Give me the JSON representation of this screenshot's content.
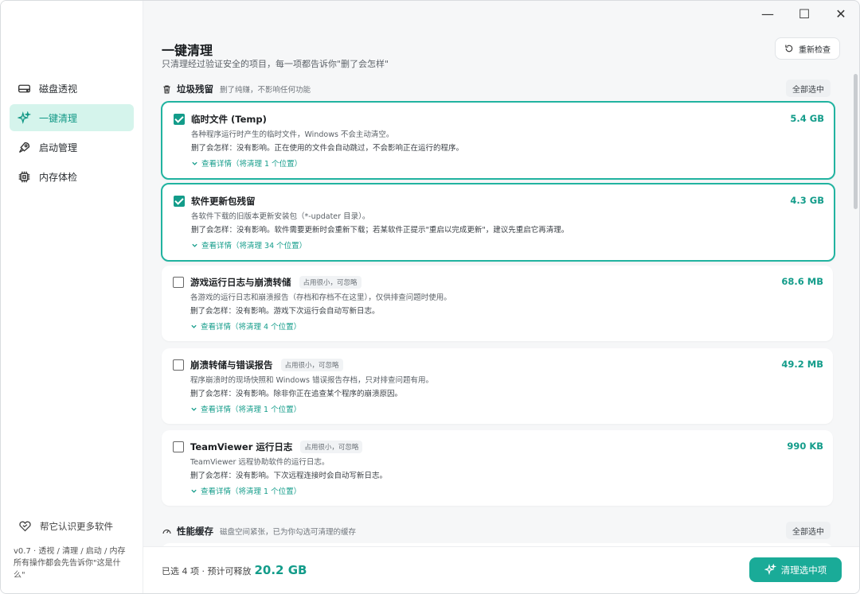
{
  "window": {
    "minimize": "—",
    "maximize": "☐",
    "close": "✕"
  },
  "sidebar": {
    "items": [
      {
        "label": "磁盘透视",
        "icon": "disk-icon",
        "active": false
      },
      {
        "label": "一键清理",
        "icon": "sparkle-icon",
        "active": true
      },
      {
        "label": "启动管理",
        "icon": "rocket-icon",
        "active": false
      },
      {
        "label": "内存体检",
        "icon": "chip-icon",
        "active": false
      }
    ],
    "help_label": "帮它认识更多软件",
    "version_text": "v0.7 · 透视 / 清理 / 启动 / 内存\n所有操作都会先告诉你\"这是什么\""
  },
  "header": {
    "title": "一键清理",
    "subtitle": "只清理经过验证安全的项目，每一项都告诉你\"删了会怎样\"",
    "recheck_label": "重新检查"
  },
  "sections": [
    {
      "title": "垃圾残留",
      "desc": "删了纯赚，不影响任何功能",
      "select_all": "全部选中",
      "items": [
        {
          "title": "临时文件 (Temp)",
          "tag": "",
          "size": "5.4 GB",
          "checked": true,
          "desc": "各种程序运行时产生的临时文件，Windows 不会主动清空。",
          "effect": "删了会怎样：没有影响。正在使用的文件会自动跳过，不会影响正在运行的程序。",
          "detail": "查看详情（将清理 1 个位置）"
        },
        {
          "title": "软件更新包残留",
          "tag": "",
          "size": "4.3 GB",
          "checked": true,
          "desc": "各软件下载的旧版本更新安装包（*-updater 目录）。",
          "effect": "删了会怎样：没有影响。软件需要更新时会重新下载；若某软件正提示\"重启以完成更新\"，建议先重启它再清理。",
          "detail": "查看详情（将清理 34 个位置）"
        },
        {
          "title": "游戏运行日志与崩溃转储",
          "tag": "占用很小，可忽略",
          "size": "68.6 MB",
          "checked": false,
          "desc": "各游戏的运行日志和崩溃报告（存档和存档不在这里），仅供排查问题时使用。",
          "effect": "删了会怎样：没有影响。游戏下次运行会自动写新日志。",
          "detail": "查看详情（将清理 4 个位置）"
        },
        {
          "title": "崩溃转储与错误报告",
          "tag": "占用很小，可忽略",
          "size": "49.2 MB",
          "checked": false,
          "desc": "程序崩溃时的现场快照和 Windows 错误报告存档，只对排查问题有用。",
          "effect": "删了会怎样：没有影响。除非你正在追查某个程序的崩溃原因。",
          "detail": "查看详情（将清理 1 个位置）"
        },
        {
          "title": "TeamViewer 运行日志",
          "tag": "占用很小，可忽略",
          "size": "990 KB",
          "checked": false,
          "desc": "TeamViewer 远程协助软件的运行日志。",
          "effect": "删了会怎样：没有影响。下次远程连接时会自动写新日志。",
          "detail": "查看详情（将清理 1 个位置）"
        }
      ]
    },
    {
      "title": "性能缓存",
      "desc": "磁盘空间紧张，已为你勾选可清理的缓存",
      "select_all": "全部选中"
    }
  ],
  "footer": {
    "summary": "已选 4 项 · 预计可释放",
    "total": "20.2 GB",
    "clean_label": "清理选中项"
  },
  "colors": {
    "accent": "#1aab98",
    "accent_text": "#139c8a",
    "active_bg": "#d5f4ec"
  }
}
